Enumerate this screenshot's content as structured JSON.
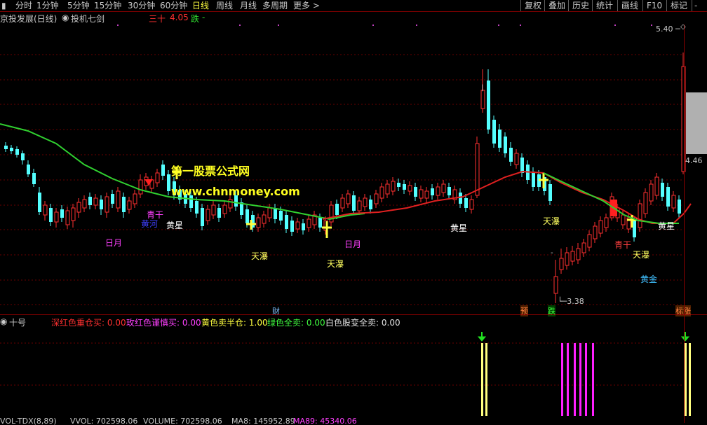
{
  "toolbar": {
    "left_items": [
      "分时",
      "1分钟",
      "5分钟",
      "15分钟",
      "30分钟",
      "60分钟",
      "日线",
      "周线",
      "月线",
      "多周期",
      "更多 >"
    ],
    "active_index": 6,
    "right_items": [
      "复权",
      "叠加",
      "历史",
      "统计",
      "画线",
      "F10",
      "标记",
      "-"
    ]
  },
  "info": {
    "stock_title": "京投发展(日线)",
    "formula_name": "投机七剑",
    "sanshi_label": "三十",
    "sanshi_value": "4.05",
    "fall_label": "跌",
    "fall_value": "-"
  },
  "watermark": {
    "line1": "第一股票公式网",
    "line2": "www.chnmoney.com"
  },
  "price_axis": {
    "high": "5.40",
    "current": "4.46",
    "low": "3.38"
  },
  "signals": [
    {
      "text": "日月",
      "color": "#ff40ff"
    },
    {
      "text": "青干",
      "color": "#ff40ff"
    },
    {
      "text": "黄河",
      "color": "#4040ff"
    },
    {
      "text": "黄星",
      "color": "#ffffff"
    },
    {
      "text": "天瀑",
      "color": "#ffff60"
    },
    {
      "text": "天瀑",
      "color": "#ffff60"
    },
    {
      "text": "日月",
      "color": "#ff40ff"
    },
    {
      "text": "黄星",
      "color": "#ffffff"
    },
    {
      "text": "天瀑",
      "color": "#ffff60"
    },
    {
      "text": "青干",
      "color": "#ff4040"
    },
    {
      "text": "天瀑",
      "color": "#ffff60"
    },
    {
      "text": "黄星",
      "color": "#ffffff"
    },
    {
      "text": "黄金",
      "color": "#40c0ff"
    }
  ],
  "markers": {
    "cai": "财",
    "yu": "预",
    "die": "跌",
    "biao_zhang": "标涨"
  },
  "sub_indicator": {
    "name": "十号",
    "deep_red_label": "深红色重仓买:",
    "deep_red_value": "0.00",
    "magenta_label": "玫红色谨慎买:",
    "magenta_value": "0.00",
    "yellow_label": "黄色卖半仓:",
    "yellow_value": "1.00",
    "green_label": "绿色全卖:",
    "green_value": "0.00",
    "white_label": "白色股变全卖:",
    "white_value": "0.00"
  },
  "volume_bar": {
    "name": "VOL-TDX(8,89)",
    "vvol_label": "VVOL:",
    "vvol_value": "702598.06",
    "volume_label": "VOLUME:",
    "volume_value": "702598.06",
    "ma8_label": "MA8:",
    "ma8_value": "145952.89",
    "ma89_label": "MA89:",
    "ma89_value": "45340.06"
  },
  "colors": {
    "up_candle": "#ff3030",
    "down_candle": "#54ffff",
    "ma_green": "#30d030",
    "ma_red": "#e02020",
    "yellow_bar": "#ffff80",
    "magenta_bar": "#ff20ff",
    "arrow_green": "#20e020"
  }
}
